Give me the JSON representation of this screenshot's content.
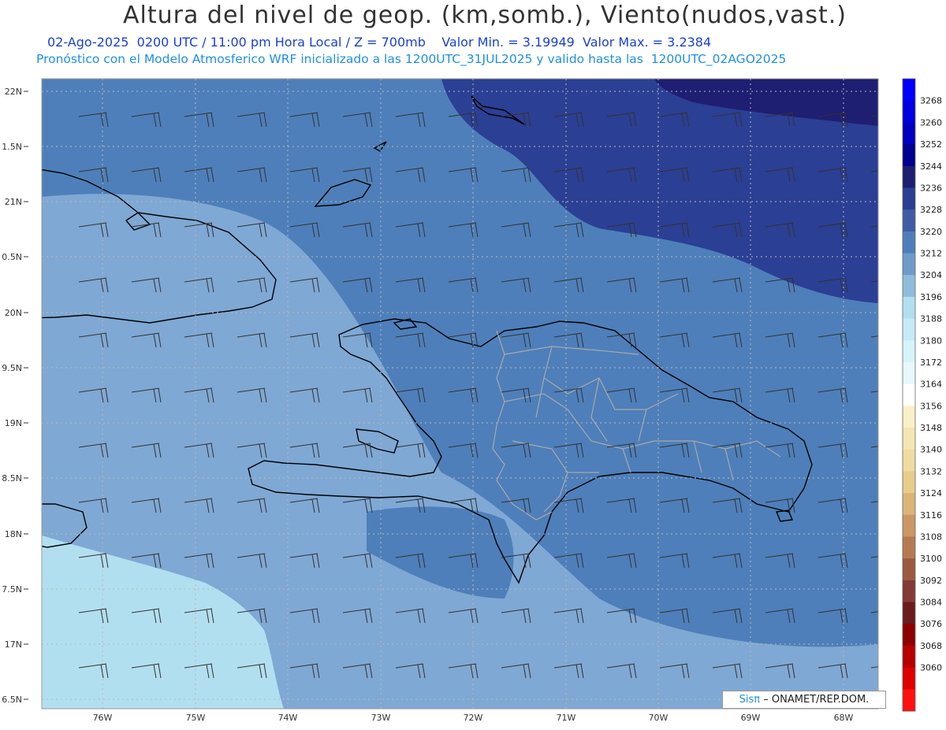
{
  "header": {
    "title": "Altura del nivel de geop. (km,somb.), Viento(nudos,vast.)",
    "line1": "02-Ago-2025  0200 UTC / 11:00 pm Hora Local / Z = 700mb    Valor Min. = 3.19949  Valor Max. = 3.2384",
    "line2": "Pronóstico con el Modelo Atmosferico WRF inicializado a las 1200UTC_31JUL2025 y valido hasta las  1200UTC_02AGO2025"
  },
  "map": {
    "lat_labels": [
      "22N",
      "1.5N",
      "21N",
      "0.5N",
      "20N",
      "9.5N",
      "19N",
      "8.5N",
      "18N",
      "7.5N",
      "17N",
      "6.5N"
    ],
    "lon_labels": [
      "76W",
      "75W",
      "74W",
      "73W",
      "72W",
      "71W",
      "70W",
      "69W",
      "68W"
    ],
    "credit_brand": "Sisπ",
    "credit_text": "– ONAMET/REP.DOM.",
    "colors": {
      "ocean_main": "#4e7fba",
      "ocean_light": "#7fa8d4",
      "ocean_pale": "#b2dff0",
      "deep": "#2b3f94",
      "deepest": "#1e1e72",
      "coast": "#000000",
      "border": "#a9a9a9"
    }
  },
  "colorbar": {
    "labels": [
      "3268",
      "3260",
      "3252",
      "3244",
      "3236",
      "3228",
      "3220",
      "3212",
      "3204",
      "3196",
      "3188",
      "3180",
      "3172",
      "3164",
      "3156",
      "3148",
      "3140",
      "3132",
      "3124",
      "3116",
      "3108",
      "3100",
      "3092",
      "3084",
      "3076",
      "3068",
      "3060"
    ],
    "colors": [
      "#0000ff",
      "#0000e0",
      "#0000c0",
      "#000090",
      "#1e1e72",
      "#2b3f94",
      "#3f5ca6",
      "#4e7fba",
      "#6f9bcb",
      "#8fbcdd",
      "#b2dff0",
      "#c6ebf6",
      "#d6f3fa",
      "#e8f8fc",
      "#ffffff",
      "#f9f0c8",
      "#f4e6b4",
      "#efdca2",
      "#e8cc8e",
      "#dcb47a",
      "#cc9766",
      "#b67a52",
      "#9c5a42",
      "#843a36",
      "#6a1c1e",
      "#8e0000",
      "#b80000",
      "#e00000",
      "#ff1010"
    ]
  }
}
